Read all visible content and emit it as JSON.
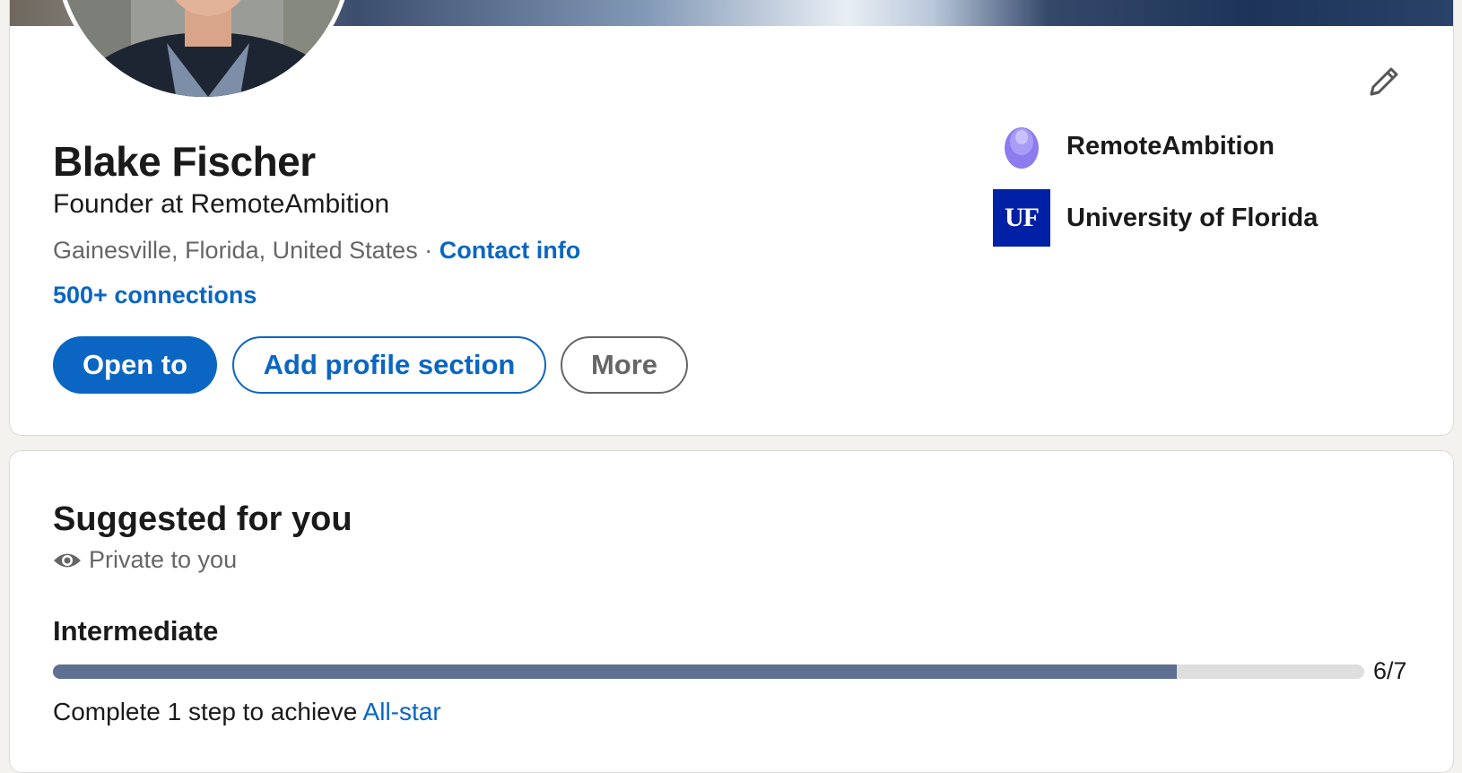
{
  "profile": {
    "name": "Blake Fischer",
    "headline": "Founder at RemoteAmbition",
    "location": "Gainesville, Florida, United States",
    "separator": "·",
    "contact_info": "Contact info",
    "connections": "500+ connections",
    "avatar": "profile-photo",
    "edit_icon": "pencil-icon"
  },
  "actions": {
    "open_to": "Open to",
    "add_section": "Add profile section",
    "more": "More"
  },
  "organizations": [
    {
      "name": "RemoteAmbition",
      "logo": "purple-egg-logo"
    },
    {
      "name": "University of Florida",
      "logo_text": "UF"
    }
  ],
  "suggested": {
    "title": "Suggested for you",
    "privacy": "Private to you",
    "privacy_icon": "eye-icon",
    "level": "Intermediate",
    "progress_completed": 6,
    "progress_total": 7,
    "progress_label": "6/7",
    "complete_text": "Complete 1 step to achieve",
    "next_level": "All-star"
  },
  "colors": {
    "brand_blue": "#0a66c2",
    "progress_fill": "#5f6f91",
    "uf_blue": "#0021a5"
  }
}
